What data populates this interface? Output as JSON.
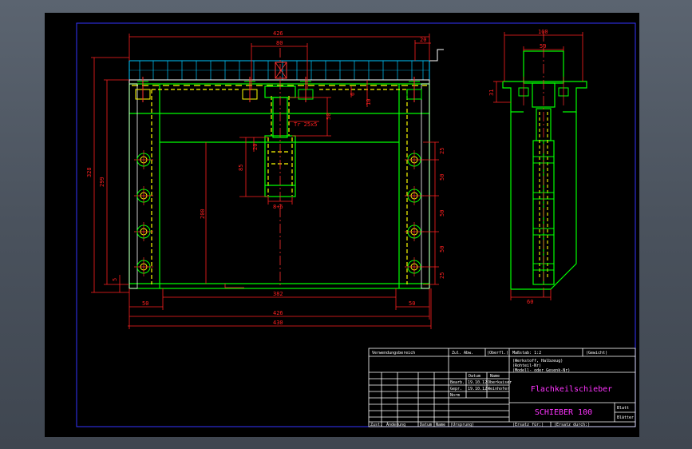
{
  "colors": {
    "background": "#000000",
    "frame": "#ffffff",
    "border": "#3333ff",
    "dimension": "#ff2020",
    "outline": "#00ff00",
    "hidden": "#ffff00",
    "center": "#ff3030",
    "hatch": "#00c8ff",
    "title_magenta": "#ff33ff",
    "chrome": "#4e5661"
  },
  "front_view": {
    "dims": {
      "top_overall": "426",
      "top_mid": "80",
      "top_right": "20",
      "left_outer": "328",
      "left_inner": "299",
      "left_small": "5",
      "thread": "Tr 25x5",
      "v50": "50",
      "v6": "6",
      "v10": "10",
      "v20": "20",
      "v85": "85",
      "v200": "200",
      "slot": "8+6",
      "bottom_382": "382",
      "bottom_left_50": "50",
      "bottom_right_50": "50",
      "bottom_426": "426",
      "bottom_430": "430",
      "right_25a": "25",
      "right_50a": "50",
      "right_50b": "50",
      "right_50c": "50",
      "right_25b": "25"
    }
  },
  "side_view": {
    "dims": {
      "top_100": "100",
      "top_50": "50",
      "left_31": "31",
      "bottom_60": "60"
    }
  },
  "title_block": {
    "usage": "Verwendungsbereich",
    "zul_abw": "Zul. Abw.",
    "oberfl": "(Oberfl.)",
    "massstab": "Maßstab: 1:2",
    "gewicht": "(Gewicht)",
    "werkstoff": "(Werkstoff, Halbzeug)",
    "rohteil": "(Rohteil-Nr)",
    "modell": "(Modell- oder Gesenk-Nr)",
    "datum": "Datum",
    "name": "Name",
    "bearb": "Bearb.",
    "gepr": "Gepr.",
    "norm": "Norm",
    "date1": "19.10.12",
    "date2": "19.10.12",
    "name1": "Oberkaiser",
    "name2": "Weinhofer",
    "title": "Flachkeilschieber",
    "number": "SCHIEBER 100",
    "blatt": "Blatt",
    "blaetter": "Blätter",
    "zust": "Zust.",
    "aenderung": "Änderung",
    "datum2": "Datum",
    "name3": "Name",
    "ursprung": "(Ursprung)",
    "ersatz_fuer": "(Ersatz für:)",
    "ersatz_durch": "(Ersatz durch:)"
  }
}
